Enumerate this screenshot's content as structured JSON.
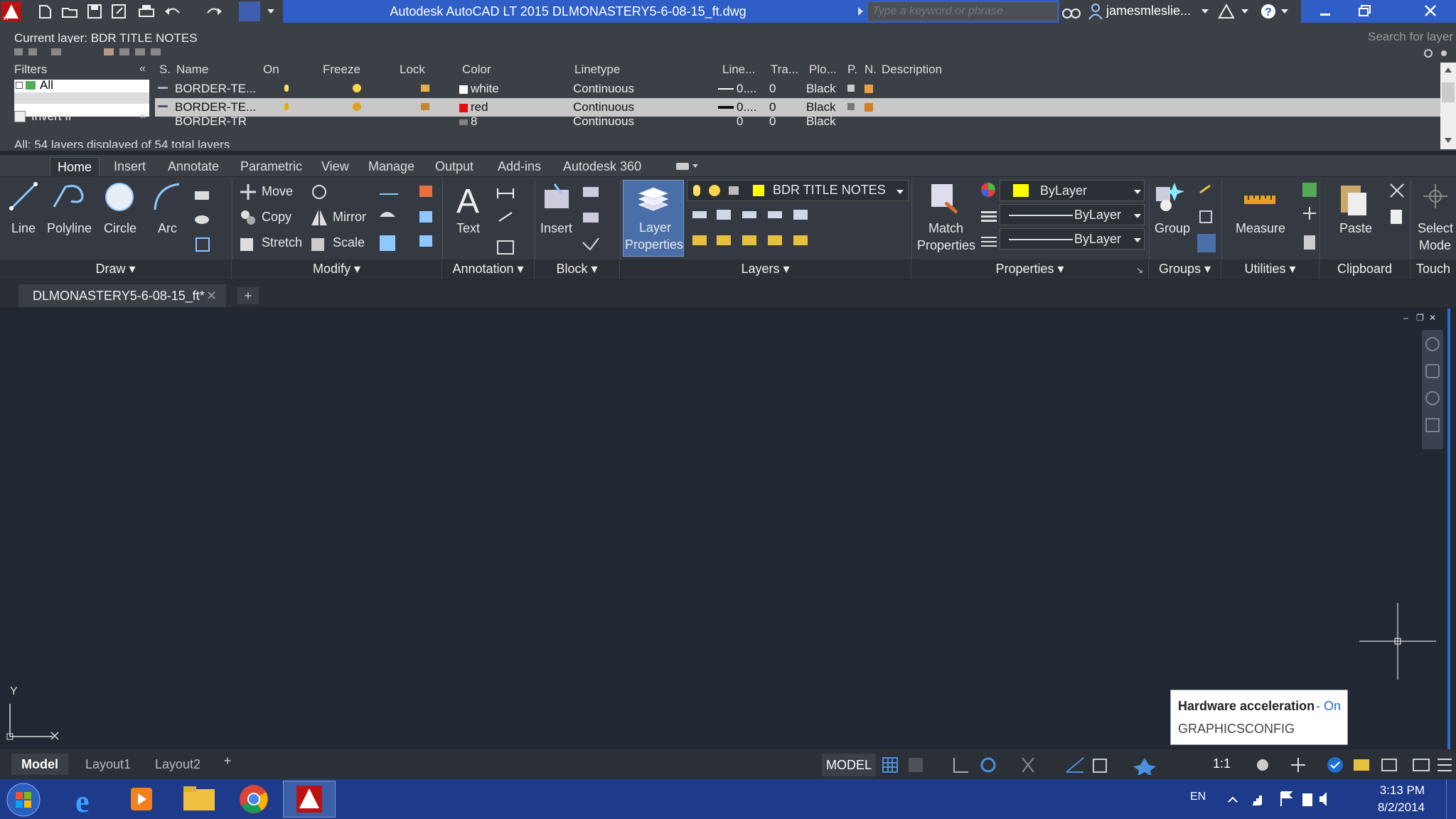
{
  "window": {
    "title": "Autodesk AutoCAD LT 2015    DLMONASTERY5-6-08-15_ft.dwg",
    "search_placeholder": "Type a keyword or phrase",
    "username": "jamesmleslie..."
  },
  "layer_panel": {
    "current_layer": "Current layer: BDR TITLE NOTES",
    "search_placeholder": "Search for layer",
    "filters_label": "Filters",
    "filter_all": "All",
    "invert_label": "Invert fi",
    "status": "All: 54 layers displayed of 54 total layers",
    "columns": [
      "S.",
      "Name",
      "On",
      "Freeze",
      "Lock",
      "Color",
      "Linetype",
      "Line...",
      "Tra...",
      "Plo...",
      "P.",
      "N.",
      "Description"
    ],
    "rows": [
      {
        "name": "BORDER-TE...",
        "color_name": "white",
        "color_hex": "#ffffff",
        "linetype": "Continuous",
        "lineweight": "0....",
        "transparency": "0",
        "plot_style": "Black"
      },
      {
        "name": "BORDER-TE...",
        "color_name": "red",
        "color_hex": "#e01010",
        "linetype": "Continuous",
        "lineweight": "0....",
        "transparency": "0",
        "plot_style": "Black"
      },
      {
        "name": "BORDER-TR",
        "color_name": "8",
        "color_hex": "#808080",
        "linetype": "Continuous",
        "lineweight": "0",
        "transparency": "0",
        "plot_style": "Black"
      }
    ]
  },
  "ribbon": {
    "tabs": [
      "Home",
      "Insert",
      "Annotate",
      "Parametric",
      "View",
      "Manage",
      "Output",
      "Add-ins",
      "Autodesk 360"
    ],
    "draw": {
      "line": "Line",
      "polyline": "Polyline",
      "circle": "Circle",
      "arc": "Arc",
      "panel": "Draw"
    },
    "modify": {
      "move": "Move",
      "copy": "Copy",
      "stretch": "Stretch",
      "mirror": "Mirror",
      "scale": "Scale",
      "panel": "Modify"
    },
    "annotation": {
      "text": "Text",
      "panel": "Annotation"
    },
    "block": {
      "insert": "Insert",
      "panel": "Block"
    },
    "layers": {
      "layer_properties_1": "Layer",
      "layer_properties_2": "Properties",
      "current": "BDR TITLE NOTES",
      "panel": "Layers"
    },
    "properties": {
      "match_1": "Match",
      "match_2": "Properties",
      "color": "ByLayer",
      "linetype": "ByLayer",
      "lineweight": "ByLayer",
      "panel": "Properties"
    },
    "groups": {
      "group": "Group",
      "panel": "Groups"
    },
    "utilities": {
      "measure": "Measure",
      "panel": "Utilities"
    },
    "clipboard": {
      "paste": "Paste",
      "panel": "Clipboard"
    },
    "touch": {
      "select_1": "Select",
      "select_2": "Mode",
      "panel": "Touch"
    }
  },
  "document_tab": "DLMONASTERY5-6-08-15_ft*",
  "layout_tabs": [
    "Model",
    "Layout1",
    "Layout2"
  ],
  "status": {
    "model": "MODEL",
    "scale": "1:1"
  },
  "notification": {
    "title": "Hardware acceleration",
    "state": "On",
    "command": "GRAPHICSCONFIG"
  },
  "ucs": {
    "y": "Y"
  },
  "taskbar": {
    "lang": "EN",
    "time": "3:13 PM",
    "date": "8/2/2014"
  },
  "colors": {
    "accent": "#2e5ec6",
    "canvas": "#212834",
    "panel": "#3b3f46",
    "layer_yellow": "#ffff00"
  }
}
